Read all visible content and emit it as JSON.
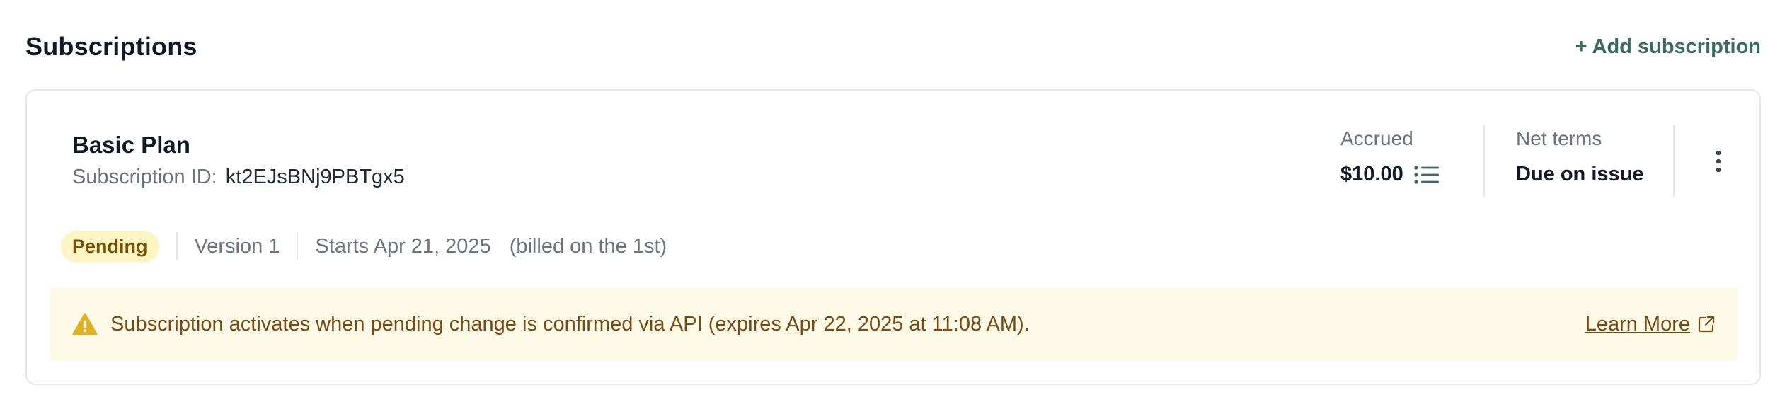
{
  "header": {
    "title": "Subscriptions",
    "add_label": "+ Add subscription"
  },
  "subscription": {
    "plan_name": "Basic Plan",
    "id_label": "Subscription ID:",
    "id_value": "kt2EJsBNj9PBTgx5",
    "accrued": {
      "label": "Accrued",
      "value": "$10.00"
    },
    "net_terms": {
      "label": "Net terms",
      "value": "Due on issue"
    },
    "status_badge": "Pending",
    "version": "Version 1",
    "start": "Starts Apr 21, 2025",
    "billing_note": "(billed on the 1st)"
  },
  "banner": {
    "message": "Subscription activates when pending change is confirmed via API (expires Apr 22, 2025 at 11:08 AM).",
    "link_label": "Learn More"
  },
  "colors": {
    "accent": "#3b6b63",
    "badge_bg": "#fdf6c4",
    "badge_text": "#7a4e00",
    "banner_bg": "#fefae8",
    "banner_text": "#7a4a12",
    "warning": "#e0b22a"
  },
  "icons": {
    "warning": "warning-triangle-icon",
    "list": "list-icon",
    "more": "kebab-menu-icon",
    "external": "external-link-icon"
  }
}
